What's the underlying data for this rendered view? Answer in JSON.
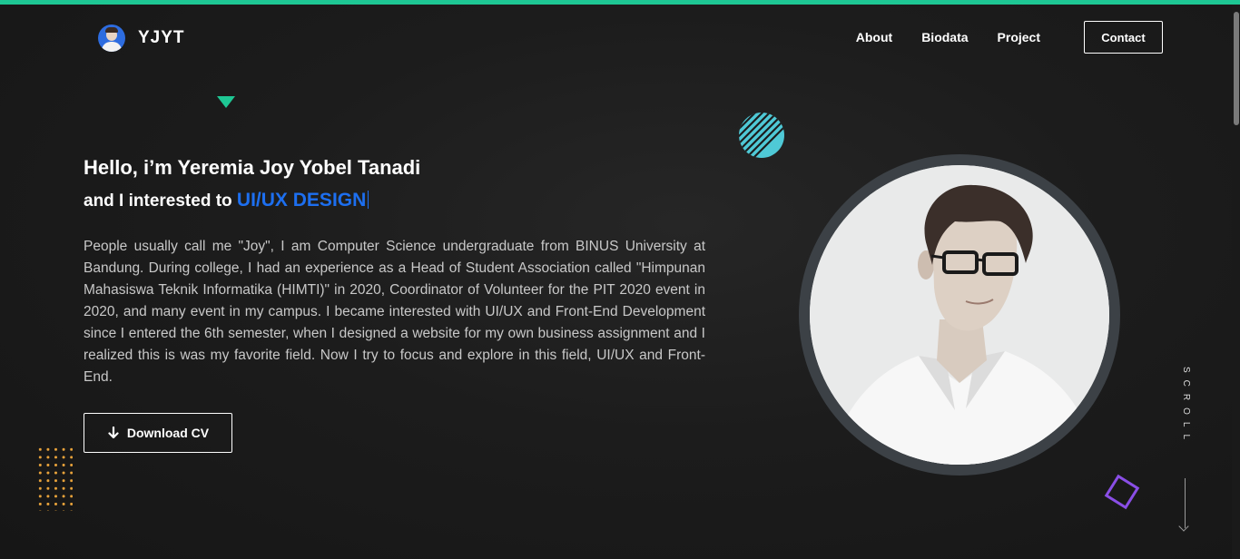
{
  "brand": {
    "name": "YJYT",
    "avatar_icon": "profile-photo"
  },
  "nav": {
    "links": [
      "About",
      "Biodata",
      "Project"
    ],
    "contact_label": "Contact"
  },
  "hero": {
    "greeting": "Hello, i’m Yeremia Joy Yobel Tanadi",
    "interest_prefix": "and I interested to ",
    "interest_highlight": "UI/UX DESIGN",
    "bio": "People usually call me \"Joy\", I am Computer Science undergraduate from BINUS University at Bandung. During college, I had an experience as a Head of Student Association called \"Himpunan Mahasiswa Teknik Informatika (HIMTI)\" in 2020, Coordinator of Volunteer for the PIT 2020 event in 2020, and many event in my campus. I became interested with UI/UX and Front-End Development since I entered the 6th semester, when I designed a website for my own business assignment and I realized this is was my favorite field. Now I try to focus and explore in this field, UI/UX and Front-End.",
    "download_label": "Download CV",
    "download_icon": "arrow-down-icon"
  },
  "scroll_label": "SCROLL",
  "colors": {
    "accent_green": "#1ec794",
    "accent_blue": "#1d6ff0",
    "accent_cyan": "#4fc9d6",
    "accent_purple": "#8a4ee6",
    "accent_orange": "#e8a23a",
    "background": "#1c1c1c"
  }
}
